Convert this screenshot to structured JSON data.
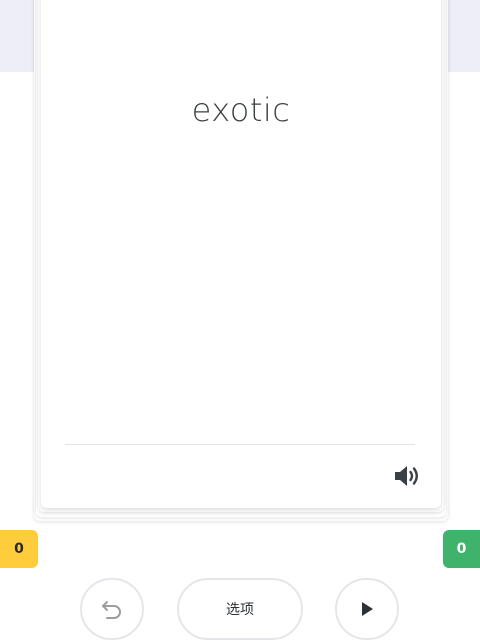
{
  "card": {
    "term": "exotic",
    "audio_icon": "speaker-volume-icon"
  },
  "counters": {
    "still_learning": "0",
    "still_learning_color": "#ffcd3c",
    "know": "0",
    "know_color": "#3fb36b"
  },
  "controls": {
    "undo_icon": "undo-arrow-icon",
    "options_label": "选项",
    "play_icon": "play-icon"
  }
}
